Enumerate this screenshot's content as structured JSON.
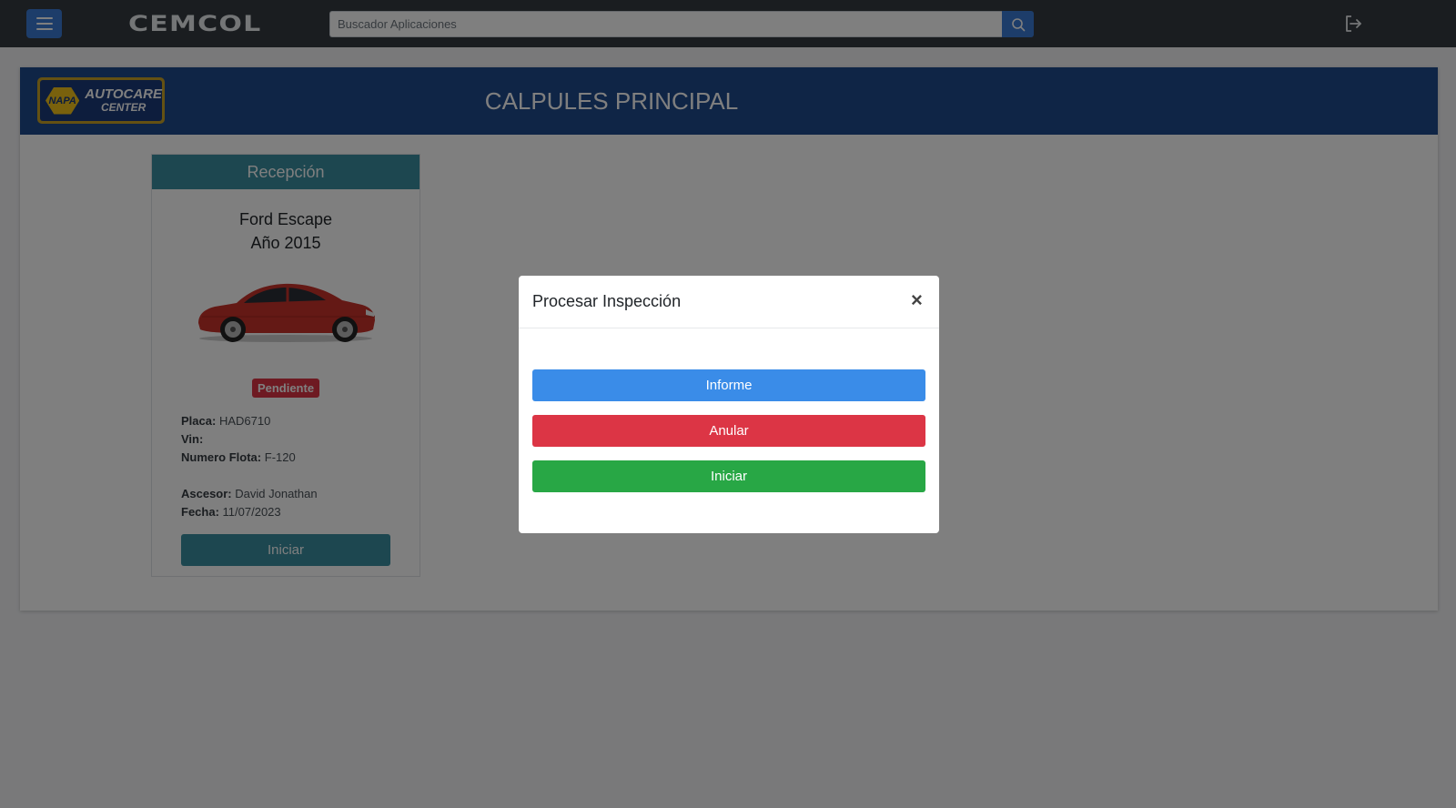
{
  "topbar": {
    "brand": "CEMCOL",
    "search_placeholder": "Buscador Aplicaciones",
    "icons": {
      "menu": "hamburger-menu-icon",
      "search": "search-icon",
      "logout": "logout-icon"
    }
  },
  "panel": {
    "logo": {
      "napa": "NAPA",
      "line1": "AUTOCARE",
      "line2": "CENTER"
    },
    "title": "CALPULES PRINCIPAL"
  },
  "card": {
    "header": "Recepción",
    "vehicle_model": "Ford Escape",
    "vehicle_year": "Año 2015",
    "status_badge": "Pendiente",
    "fields": {
      "placa_label": "Placa:",
      "placa_value": "HAD6710",
      "vin_label": "Vin:",
      "vin_value": "",
      "flota_label": "Numero Flota:",
      "flota_value": "F-120",
      "ascesor_label": "Ascesor:",
      "ascesor_value": "David Jonathan",
      "fecha_label": "Fecha:",
      "fecha_value": "11/07/2023"
    },
    "button": "Iniciar"
  },
  "modal": {
    "title": "Procesar Inspección",
    "close": "×",
    "buttons": {
      "informe": "Informe",
      "anular": "Anular",
      "iniciar": "Iniciar"
    }
  },
  "colors": {
    "topbar": "#343a40",
    "primary": "#3a7bd5",
    "panel_header": "#1f4a8c",
    "card_accent": "#3a8ea0",
    "danger": "#dc3545",
    "success": "#28a745"
  }
}
